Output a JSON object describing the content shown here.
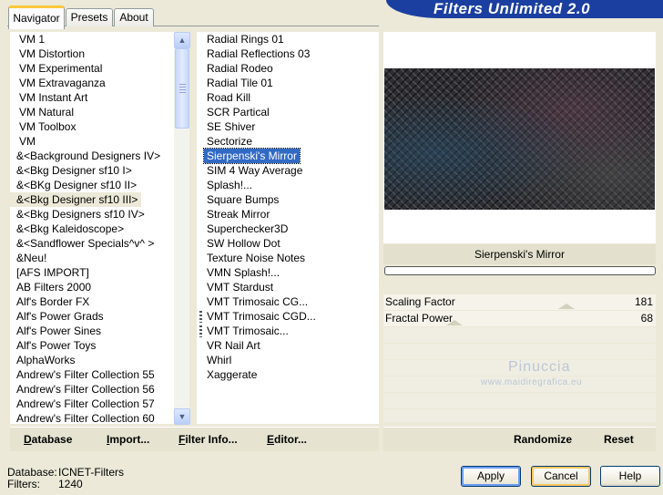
{
  "banner": {
    "title": "Filters Unlimited 2.0"
  },
  "tabs": [
    {
      "label": "Navigator",
      "active": true
    },
    {
      "label": "Presets",
      "active": false
    },
    {
      "label": "About",
      "active": false
    }
  ],
  "categories": [
    "VM 1",
    "VM Distortion",
    "VM Experimental",
    "VM Extravaganza",
    "VM Instant Art",
    "VM Natural",
    "VM Toolbox",
    "VM",
    "&<Background Designers IV>",
    "&<Bkg Designer sf10 I>",
    "&<BKg Designer sf10 II>",
    "&<Bkg Designer sf10 III>",
    "&<Bkg Designers sf10 IV>",
    "&<Bkg Kaleidoscope>",
    "&<Sandflower Specials^v^ >",
    "&Neu!",
    "[AFS IMPORT]",
    "AB Filters 2000",
    "Alf's Border FX",
    "Alf's Power Grads",
    "Alf's Power Sines",
    "Alf's Power Toys",
    "AlphaWorks",
    "Andrew's Filter Collection 55",
    "Andrew's Filter Collection 56",
    "Andrew's Filter Collection 57",
    "Andrew's Filter Collection 60"
  ],
  "selected_category": "&<Bkg Designer sf10 III>",
  "filters": [
    "Radial  Rings 01",
    "Radial Reflections 03",
    "Radial Rodeo",
    "Radial Tile 01",
    "Road Kill",
    "SCR  Partical",
    "SE Shiver",
    "Sectorize",
    "Sierpenski's Mirror",
    "SIM 4 Way Average",
    "Splash!...",
    "Square Bumps",
    "Streak Mirror",
    "Superchecker3D",
    "SW Hollow Dot",
    "Texture Noise Notes",
    "VMN Splash!...",
    "VMT Stardust",
    "VMT Trimosaic CG...",
    "VMT Trimosaic CGD...",
    "VMT Trimosaic...",
    "VR Nail Art",
    "Whirl",
    "Xaggerate"
  ],
  "selected_filter": "Sierpenski's Mirror",
  "preview": {
    "filter_name": "Sierpenski's Mirror",
    "params": [
      {
        "label": "Scaling Factor",
        "value": "181",
        "level": 0.71
      },
      {
        "label": "Fractal Power",
        "value": "68",
        "level": 0.27
      }
    ]
  },
  "watermark": {
    "text": "Pinuccia",
    "sub": "www.maidiregrafica.eu"
  },
  "toolbar": {
    "database": "Database",
    "import": "Import...",
    "filter_info": "Filter Info...",
    "editor": "Editor...",
    "randomize": "Randomize",
    "reset": "Reset"
  },
  "info": {
    "database_label": "Database:",
    "database_value": "ICNET-Filters",
    "filters_label": "Filters:",
    "filters_value": "1240"
  },
  "buttons": {
    "apply": "Apply",
    "cancel": "Cancel",
    "help": "Help"
  }
}
